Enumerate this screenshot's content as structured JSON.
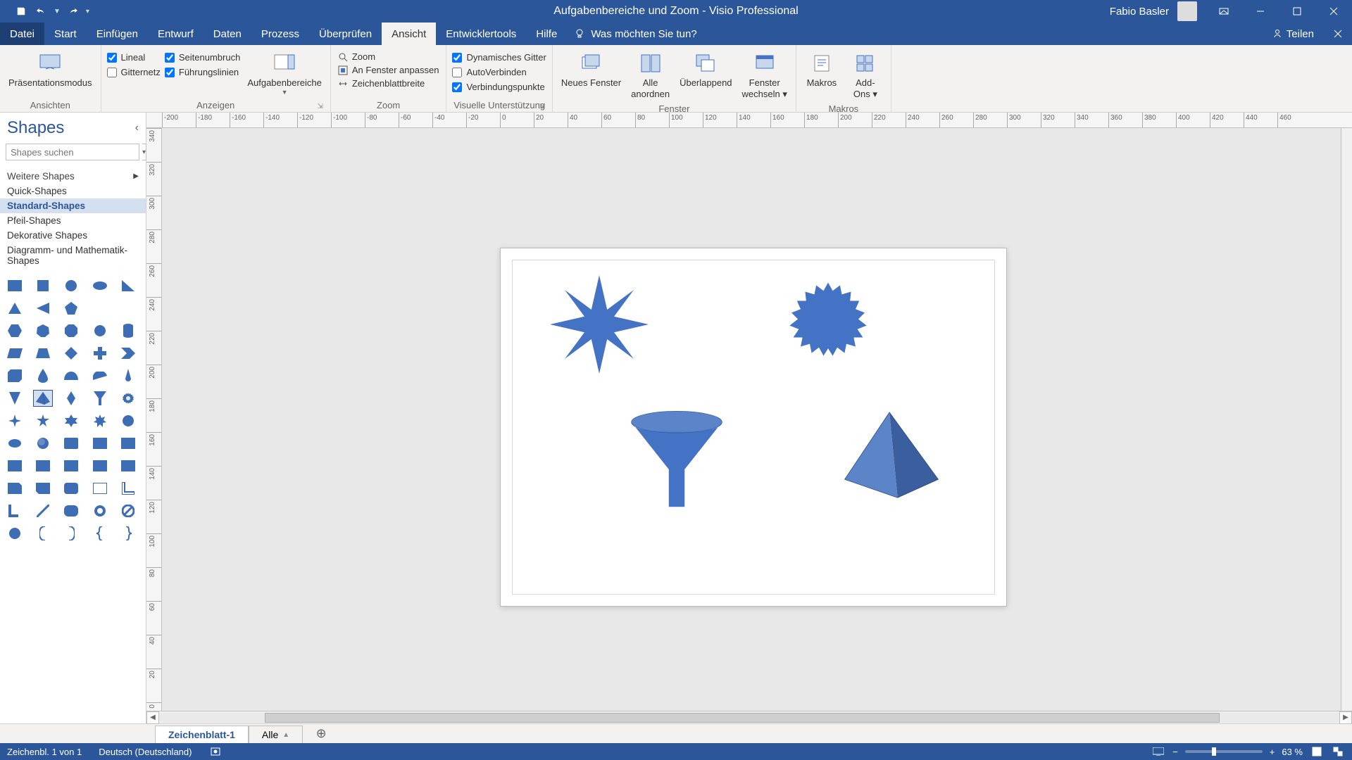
{
  "title": {
    "doc": "Aufgabenbereiche und Zoom",
    "sep": "  -  ",
    "app": "Visio Professional"
  },
  "user": "Fabio Basler",
  "menu": [
    "Datei",
    "Start",
    "Einfügen",
    "Entwurf",
    "Daten",
    "Prozess",
    "Überprüfen",
    "Ansicht",
    "Entwicklertools",
    "Hilfe"
  ],
  "active_menu": "Ansicht",
  "tellme": "Was möchten Sie tun?",
  "share": "Teilen",
  "ribbon": {
    "ansichten": {
      "label": "Ansichten",
      "praesentation": "Präsentationsmodus"
    },
    "anzeigen": {
      "label": "Anzeigen",
      "lineal": "Lineal",
      "seitenumbruch": "Seitenumbruch",
      "gitternetz": "Gitternetz",
      "fuehrungslinien": "Führungslinien",
      "aufgabenbereiche": "Aufgabenbereiche"
    },
    "zoom": {
      "label": "Zoom",
      "zoom": "Zoom",
      "anfenster": "An Fenster anpassen",
      "zeichenblatt": "Zeichenblattbreite"
    },
    "visuell": {
      "label": "Visuelle Unterstützung",
      "dyn": "Dynamisches Gitter",
      "auto": "AutoVerbinden",
      "verb": "Verbindungspunkte"
    },
    "fenster": {
      "label": "Fenster",
      "neues": "Neues Fenster",
      "alle": "Alle anordnen",
      "ueber": "Überlappend",
      "wechseln": "Fenster wechseln"
    },
    "makros": {
      "label": "Makros",
      "makros": "Makros",
      "addons": "Add-Ons"
    }
  },
  "shapes": {
    "title": "Shapes",
    "search_placeholder": "Shapes suchen",
    "more": "Weitere Shapes",
    "stencils": [
      "Quick-Shapes",
      "Standard-Shapes",
      "Pfeil-Shapes",
      "Dekorative Shapes",
      "Diagramm- und Mathematik-Shapes"
    ],
    "selected": "Standard-Shapes"
  },
  "rulerh": [
    "-200",
    "-180",
    "-160",
    "-140",
    "-120",
    "-100",
    "-80",
    "-60",
    "-40",
    "-20",
    "0",
    "20",
    "40",
    "60",
    "80",
    "100",
    "120",
    "140",
    "160",
    "180",
    "200",
    "220",
    "240",
    "260",
    "280",
    "300",
    "320",
    "340",
    "360",
    "380",
    "400",
    "420",
    "440",
    "460"
  ],
  "rulerv": [
    "340",
    "320",
    "300",
    "280",
    "260",
    "240",
    "220",
    "200",
    "180",
    "160",
    "140",
    "120",
    "100",
    "80",
    "60",
    "40",
    "20",
    "0"
  ],
  "pagetabs": {
    "page1": "Zeichenblatt-1",
    "all": "Alle"
  },
  "status": {
    "page": "Zeichenbl. 1 von 1",
    "lang": "Deutsch (Deutschland)",
    "zoom": "63 %"
  }
}
